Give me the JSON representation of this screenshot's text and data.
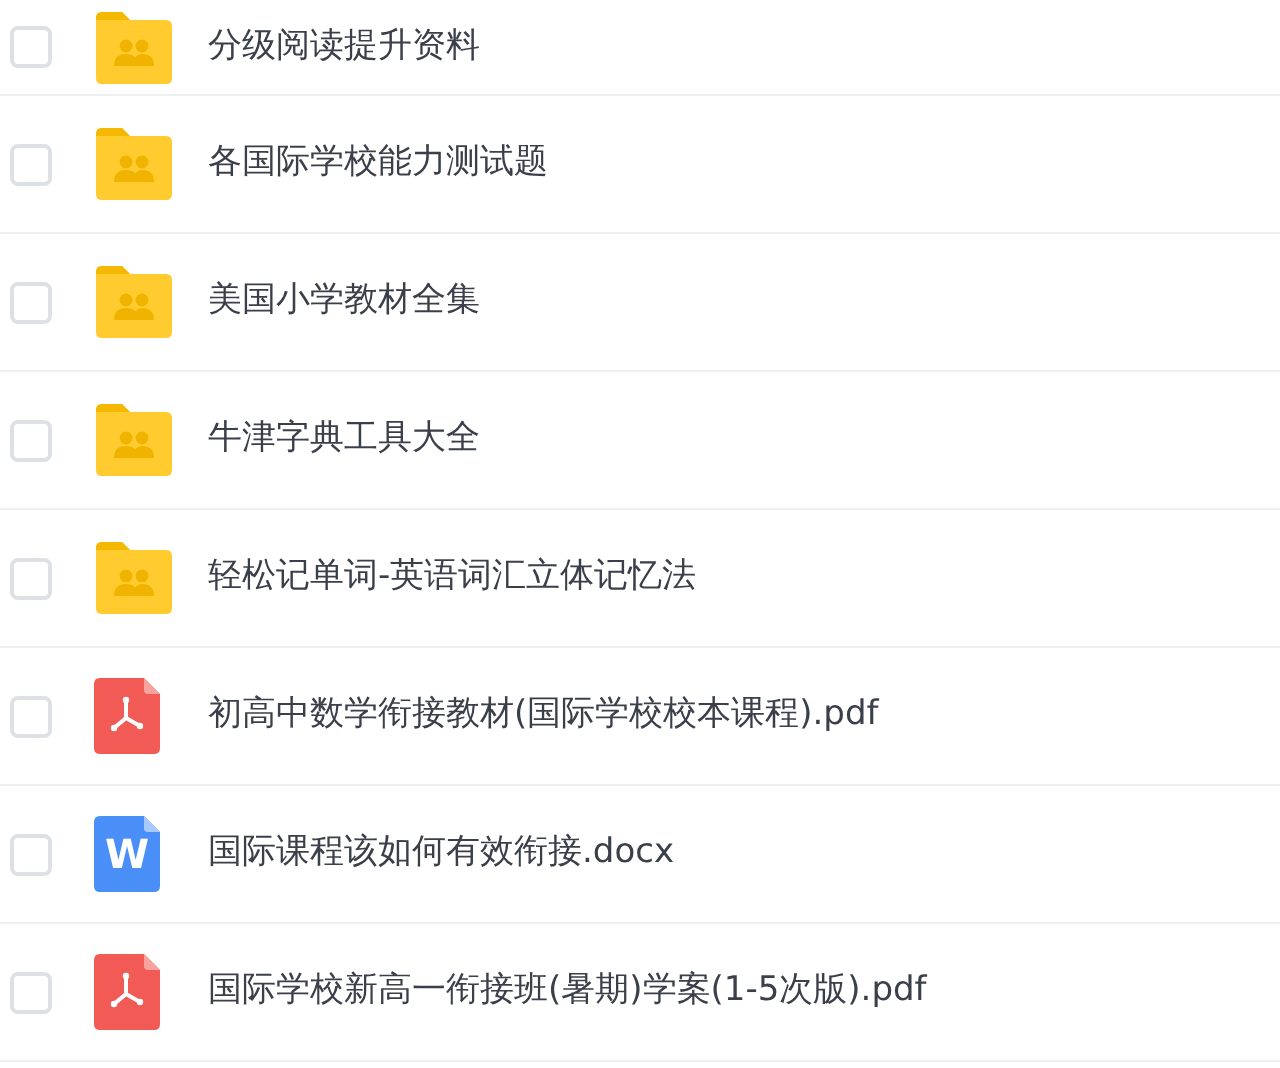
{
  "files": [
    {
      "kind": "folder",
      "name": "分级阅读提升资料",
      "checked": false
    },
    {
      "kind": "folder",
      "name": "各国际学校能力测试题",
      "checked": false
    },
    {
      "kind": "folder",
      "name": "美国小学教材全集",
      "checked": false
    },
    {
      "kind": "folder",
      "name": "牛津字典工具大全",
      "checked": false
    },
    {
      "kind": "folder",
      "name": "轻松记单词-英语词汇立体记忆法",
      "checked": false
    },
    {
      "kind": "pdf",
      "name": "初高中数学衔接教材(国际学校校本课程).pdf",
      "checked": false
    },
    {
      "kind": "word",
      "name": "国际课程该如何有效衔接.docx",
      "checked": false,
      "icon_letter": "W"
    },
    {
      "kind": "pdf",
      "name": "国际学校新高一衔接班(暑期)学案(1-5次版).pdf",
      "checked": false
    }
  ]
}
